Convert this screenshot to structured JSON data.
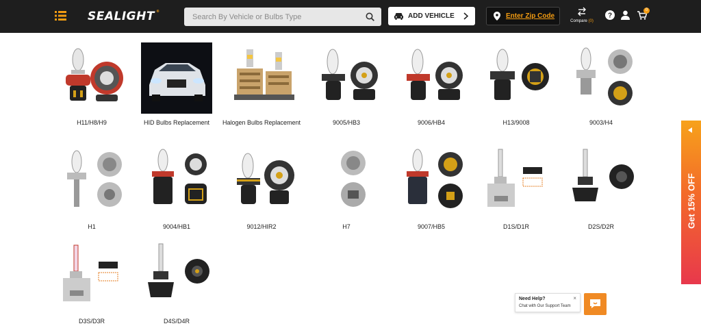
{
  "header": {
    "logo_text": "SEALIGHT",
    "logo_mark": "®",
    "search_placeholder": "Search By Vehicle or Bulbs Type",
    "add_vehicle_label": "ADD VEHICLE",
    "zip_label": "Enter Zip Code",
    "compare_label": "Compare",
    "compare_count": "(0)",
    "cart_count": "0",
    "accent_color": "#f39c12"
  },
  "products": [
    {
      "label": "H11/H8/H9",
      "icon": "h11-bulb-icon"
    },
    {
      "label": "HID Bulbs Replacement",
      "icon": "suv-car-photo"
    },
    {
      "label": "Halogen Bulbs Replacement",
      "icon": "led-bulbs-icon"
    },
    {
      "label": "9005/HB3",
      "icon": "9005-bulb-icon"
    },
    {
      "label": "9006/HB4",
      "icon": "9006-bulb-icon"
    },
    {
      "label": "H13/9008",
      "icon": "h13-bulb-icon"
    },
    {
      "label": "9003/H4",
      "icon": "9003-bulb-icon"
    },
    {
      "label": "H1",
      "icon": "h1-bulb-icon"
    },
    {
      "label": "9004/HB1",
      "icon": "9004-bulb-icon"
    },
    {
      "label": "9012/HIR2",
      "icon": "9012-bulb-icon"
    },
    {
      "label": "H7",
      "icon": "h7-bulb-icon"
    },
    {
      "label": "9007/HB5",
      "icon": "9007-bulb-icon"
    },
    {
      "label": "D1S/D1R",
      "icon": "d1s-bulb-icon"
    },
    {
      "label": "D2S/D2R",
      "icon": "d2s-bulb-icon"
    },
    {
      "label": "D3S/D3R",
      "icon": "d3s-bulb-icon"
    },
    {
      "label": "D4S/D4R",
      "icon": "d4s-bulb-icon"
    }
  ],
  "promo": {
    "text": "Get 15% OFF"
  },
  "chat": {
    "title": "Need Help?",
    "subtitle": "Chat with Our Support Team",
    "close": "×"
  }
}
